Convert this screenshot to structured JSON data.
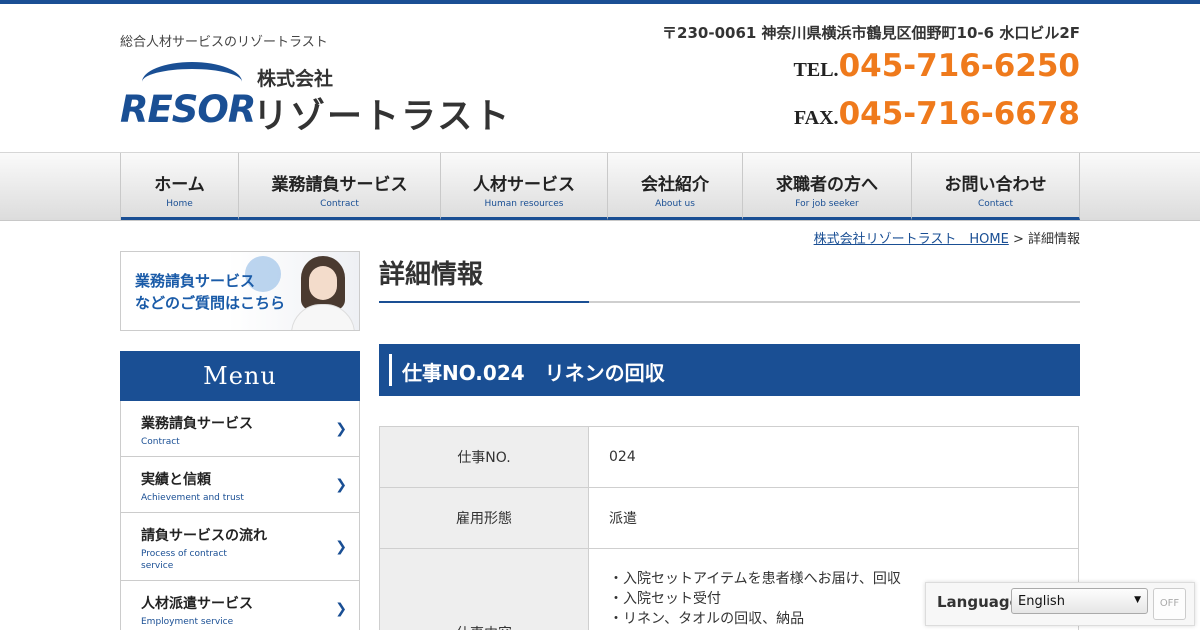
{
  "header": {
    "tagline": "総合人材サービスのリゾートラスト",
    "logo": {
      "mark": "RESOR",
      "company_prefix": "株式会社",
      "company_name": "リゾートラスト"
    },
    "address": "〒230-0061 神奈川県横浜市鶴見区佃野町10-6 水口ビル2F",
    "tel_label": "TEL.",
    "tel": "045-716-6250",
    "fax_label": "FAX.",
    "fax": "045-716-6678"
  },
  "colors": {
    "brand": "#1a4f94",
    "accent": "#ef7a1c"
  },
  "global_nav": [
    {
      "label": "ホーム",
      "sub": "Home"
    },
    {
      "label": "業務請負サービス",
      "sub": "Contract"
    },
    {
      "label": "人材サービス",
      "sub": "Human resources"
    },
    {
      "label": "会社紹介",
      "sub": "About us"
    },
    {
      "label": "求職者の方へ",
      "sub": "For job seeker"
    },
    {
      "label": "お問い合わせ",
      "sub": "Contact"
    }
  ],
  "breadcrumb": {
    "home": "株式会社リゾートラスト　HOME",
    "separator": ">",
    "current": "詳細情報"
  },
  "sidebar": {
    "banner_line1": "業務請負サービス",
    "banner_line2": "などのご質問はこちら",
    "menu_title": "Menu",
    "items": [
      {
        "label": "業務請負サービス",
        "sub": "Contract"
      },
      {
        "label": "実績と信頼",
        "sub": "Achievement and trust"
      },
      {
        "label": "請負サービスの流れ",
        "sub": "Process of contract service"
      },
      {
        "label": "人材派遣サービス",
        "sub": "Employment service"
      },
      {
        "label": "",
        "sub": ""
      }
    ]
  },
  "main": {
    "page_title": "詳細情報",
    "job_heading": "仕事NO.024　リネンの回収",
    "details": [
      {
        "key": "仕事NO.",
        "value": "024"
      },
      {
        "key": "雇用形態",
        "value": "派遣"
      },
      {
        "key": "仕事内容",
        "lines": [
          "・入院セットアイテムを患者様へお届け、回収",
          "・入院セット受付",
          "・リネン、タオルの回収、納品"
        ]
      }
    ]
  },
  "language_widget": {
    "label": "Language",
    "selected": "English",
    "off_label": "OFF"
  }
}
